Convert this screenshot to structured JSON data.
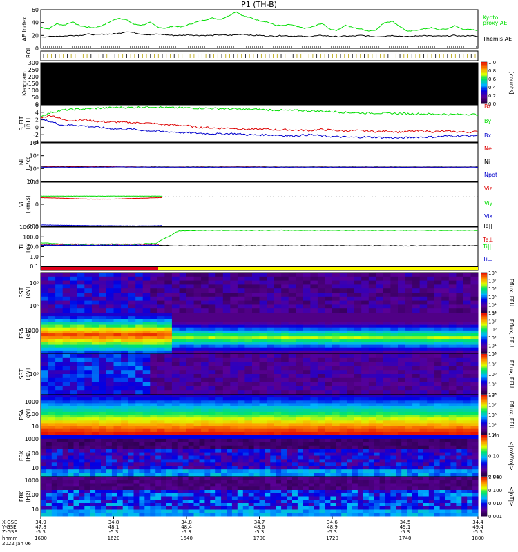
{
  "title": "P1  (TH-B)",
  "colors": {
    "green": "#00dd00",
    "red": "#dd0000",
    "blue": "#0000cc",
    "black": "#000000",
    "yellow": "#ffff00",
    "mode_red": "#e0001a"
  },
  "chart_data": [
    {
      "type": "line",
      "panel": "ae",
      "ylabel": "AE Index",
      "ylim": [
        0,
        60
      ],
      "yticks": [
        "60",
        "40",
        "20",
        "0"
      ],
      "series": [
        {
          "name": "Kyoto proxy AE",
          "color": "green",
          "values": [
            33,
            30,
            38,
            36,
            41,
            35,
            33,
            32,
            36,
            42,
            47,
            44,
            37,
            36,
            40,
            33,
            31,
            35,
            33,
            37,
            41,
            44,
            47,
            45,
            50,
            57,
            50,
            47,
            43,
            41,
            36,
            35,
            37,
            33,
            31,
            34,
            39,
            30,
            28,
            36,
            32,
            30,
            27,
            29,
            40,
            42,
            34,
            26,
            28,
            30,
            32,
            29,
            30,
            35,
            30,
            29,
            28
          ]
        },
        {
          "name": "Themis AE",
          "color": "black",
          "values": [
            18,
            18,
            19,
            19,
            20,
            20,
            22,
            21,
            22,
            22,
            23,
            26,
            24,
            22,
            21,
            22,
            21,
            20,
            20,
            21,
            20,
            20,
            20,
            21,
            20,
            21,
            22,
            20,
            20,
            19,
            19,
            20,
            19,
            19,
            18,
            19,
            20,
            19,
            18,
            19,
            19,
            20,
            19,
            18,
            19,
            20,
            19,
            18,
            19,
            20,
            19,
            19,
            19,
            20,
            19,
            20,
            18
          ]
        }
      ]
    },
    {
      "type": "heatmap",
      "panel": "keogram",
      "ylabel": "Keogram",
      "ylim": [
        0,
        300
      ],
      "yticks": [
        "300",
        "250",
        "200",
        "150",
        "100",
        "50",
        "0"
      ],
      "colorbar": {
        "label": "[counts]",
        "ticks": [
          "1.0",
          "0.8",
          "0.6",
          "0.4",
          "0.2",
          "0.0"
        ]
      }
    },
    {
      "type": "line",
      "panel": "bfield",
      "ylabel": "B_FIT\n[nT]",
      "ylim": [
        -4,
        6
      ],
      "yticks": [
        "6",
        "4",
        "2",
        "0",
        "-2",
        "-4"
      ],
      "series": [
        {
          "name": "Bz",
          "color": "red",
          "values": [
            2.6,
            3.2,
            2.0,
            1.8,
            2.0,
            1.6,
            1.4,
            1.4,
            1.2,
            1.2,
            1.0,
            0.7,
            0.6,
            0.4,
            0.0,
            -0.1,
            -0.3,
            -0.2,
            -0.5,
            -0.6,
            -0.5,
            -0.7,
            -0.7,
            -0.8,
            -0.9,
            -0.6,
            -0.8,
            -1.0,
            -0.9,
            -1.0,
            -1.2,
            -1.0,
            -1.3,
            -1.1,
            -1.0,
            -1.2,
            -1.1,
            -1.2,
            -1.3,
            -1.2
          ]
        },
        {
          "name": "By",
          "color": "green",
          "values": [
            3.0,
            4.0,
            4.6,
            4.8,
            4.9,
            5.1,
            5.2,
            5.3,
            5.3,
            5.4,
            5.5,
            5.3,
            5.2,
            5.2,
            5.1,
            5.1,
            5.0,
            4.9,
            4.8,
            4.8,
            4.7,
            4.6,
            4.5,
            4.5,
            4.4,
            4.3,
            4.2,
            4.0,
            3.9,
            3.8,
            3.8,
            3.7,
            3.7,
            3.6,
            3.6,
            3.5,
            3.5,
            3.4,
            3.5,
            3.4
          ]
        },
        {
          "name": "Bx",
          "color": "blue",
          "values": [
            2.2,
            1.4,
            0.5,
            0.6,
            0.3,
            0.0,
            -0.3,
            -0.5,
            -0.5,
            -0.8,
            -1.0,
            -1.2,
            -1.3,
            -1.5,
            -1.6,
            -1.7,
            -1.8,
            -1.7,
            -1.9,
            -2.1,
            -2.0,
            -2.1,
            -2.3,
            -2.2,
            -2.0,
            -2.3,
            -2.5,
            -2.6,
            -2.7,
            -2.6,
            -2.7,
            -2.8,
            -2.9,
            -2.7,
            -2.6,
            -2.6,
            -2.4,
            -2.3,
            -2.3,
            -2.2
          ]
        }
      ]
    },
    {
      "type": "line",
      "panel": "density",
      "ylabel": "Ni\n[1/cc]",
      "yscale": "log",
      "yticks": [
        "10⁴",
        "10²",
        "10⁰",
        "10⁻²"
      ],
      "series": [
        {
          "name": "Ne",
          "color": "red",
          "values": [
            1.1,
            1.2,
            1.1,
            1.0,
            1.0,
            1.1,
            1.0,
            1.0,
            0.9,
            0.9,
            0.9,
            1.0
          ]
        },
        {
          "name": "Ni",
          "color": "black",
          "values": [
            1.0,
            1.0,
            1.0,
            1.0,
            1.0,
            1.0,
            1.0,
            1.0,
            1.0,
            1.0,
            1.0,
            1.0
          ]
        },
        {
          "name": "Npot",
          "color": "blue",
          "values": [
            0.9,
            0.9,
            1.0,
            0.9,
            0.9,
            0.9,
            0.9,
            0.9,
            0.9,
            0.9,
            0.9,
            0.9
          ]
        }
      ]
    },
    {
      "type": "line",
      "panel": "velocity",
      "ylabel": "Vi\n[km/s]",
      "ylim": [
        -400,
        200
      ],
      "yticks": [
        "200",
        "0",
        "-200"
      ],
      "series": [
        {
          "name": "Viz",
          "color": "red",
          "values": [
            -10,
            -20,
            -30,
            -30,
            -20,
            -10
          ]
        },
        {
          "name": "Viy",
          "color": "green",
          "values": [
            10,
            10,
            10,
            10,
            10,
            10
          ]
        },
        {
          "name": "Vix",
          "color": "blue",
          "values": [
            -380,
            -385,
            -390,
            -392,
            -395,
            -390
          ]
        }
      ]
    },
    {
      "type": "line",
      "panel": "temperature",
      "ylabel": "Ti\n[eV]",
      "yscale": "log",
      "yticks": [
        "1000.0",
        "100.0",
        "10.0",
        "1.0",
        "0.1"
      ],
      "series": [
        {
          "name": "Te||",
          "color": "black",
          "values": [
            15,
            14,
            14,
            14,
            14,
            14,
            13,
            13,
            13,
            13,
            13,
            13,
            13,
            13,
            13,
            13,
            13,
            13,
            13,
            13
          ]
        },
        {
          "name": "Te⊥",
          "color": "red",
          "values": [
            20,
            20,
            20,
            20
          ]
        },
        {
          "name": "Ti||",
          "color": "green",
          "values": [
            30,
            20,
            20,
            20,
            20,
            25,
            700,
            800,
            800,
            800,
            800,
            800,
            800,
            800,
            800,
            800,
            800,
            800,
            800,
            800
          ]
        },
        {
          "name": "Ti⊥",
          "color": "blue",
          "values": [
            15,
            15,
            15,
            15
          ]
        }
      ]
    },
    {
      "type": "heatmap",
      "panel": "sst1",
      "ylabel": "SST\n[eV]",
      "yticks": [
        "10⁶",
        "10⁵"
      ],
      "colorbar": {
        "label": "Eflux, EFU",
        "ticks": [
          "10⁸",
          "10⁷",
          "10⁶",
          "10⁵",
          "10⁴",
          "10³"
        ]
      }
    },
    {
      "type": "heatmap",
      "panel": "esa1",
      "ylabel": "ESA\n[eV]",
      "yticks": [
        "1000"
      ],
      "colorbar": {
        "label": "Eflux, EFU",
        "ticks": [
          "10⁸",
          "10⁷",
          "10⁶",
          "10⁵",
          "10⁴",
          "10³"
        ]
      }
    },
    {
      "type": "heatmap",
      "panel": "sst2",
      "ylabel": "SST\n[eV]",
      "yticks": [
        "10⁵"
      ],
      "colorbar": {
        "label": "Eflux, EFU",
        "ticks": [
          "10⁸",
          "10⁷",
          "10⁶",
          "10⁵",
          "10⁴"
        ]
      }
    },
    {
      "type": "heatmap",
      "panel": "esa2",
      "ylabel": "ESA\n[eV]",
      "yticks": [
        "1000",
        "100",
        "10"
      ],
      "colorbar": {
        "label": "Eflux, EFU",
        "ticks": [
          "10⁸",
          "10⁷",
          "10⁶",
          "10⁵",
          "10⁴"
        ]
      }
    },
    {
      "type": "heatmap",
      "panel": "fbk1",
      "ylabel": "FBK\n[Hz]",
      "yticks": [
        "1000",
        "100",
        "10"
      ],
      "colorbar": {
        "label": "<|mV/m|>",
        "ticks": [
          "1.00",
          "0.10",
          "0.01"
        ]
      }
    },
    {
      "type": "heatmap",
      "panel": "fbk2",
      "ylabel": "FBK\n[Hz]",
      "yticks": [
        "1000",
        "100",
        "10"
      ],
      "colorbar": {
        "label": "<|nT|>",
        "ticks": [
          "1.000",
          "0.100",
          "0.010",
          "0.001"
        ]
      }
    }
  ],
  "legends": {
    "ae": [
      "Kyoto\nproxy AE",
      "Themis AE"
    ],
    "bfield": [
      "Bz",
      "By",
      "Bx"
    ],
    "density": [
      "Ne",
      "Ni",
      "Npot"
    ],
    "velocity": [
      "Viz",
      "Viy",
      "Vix"
    ],
    "temperature": [
      "Te||",
      "Te⊥",
      "Ti||",
      "Ti⊥"
    ]
  },
  "roi_label": "ROI",
  "xaxis": {
    "row_labels": [
      "X-GSE",
      "Y-GSE",
      "Z-GSE",
      "hhmm",
      "2022 Jan 06"
    ],
    "columns": [
      {
        "vals": [
          "34.9",
          "47.8",
          "-5.3",
          "1600"
        ]
      },
      {
        "vals": [
          "34.8",
          "48.1",
          "-5.3",
          "1620"
        ]
      },
      {
        "vals": [
          "34.8",
          "48.4",
          "-5.3",
          "1640"
        ]
      },
      {
        "vals": [
          "34.7",
          "48.6",
          "-5.3",
          "1700"
        ]
      },
      {
        "vals": [
          "34.6",
          "48.9",
          "-5.3",
          "1720"
        ]
      },
      {
        "vals": [
          "34.5",
          "49.1",
          "-5.3",
          "1740"
        ]
      },
      {
        "vals": [
          "34.4",
          "49.4",
          "-5.3",
          "1800"
        ]
      }
    ]
  }
}
